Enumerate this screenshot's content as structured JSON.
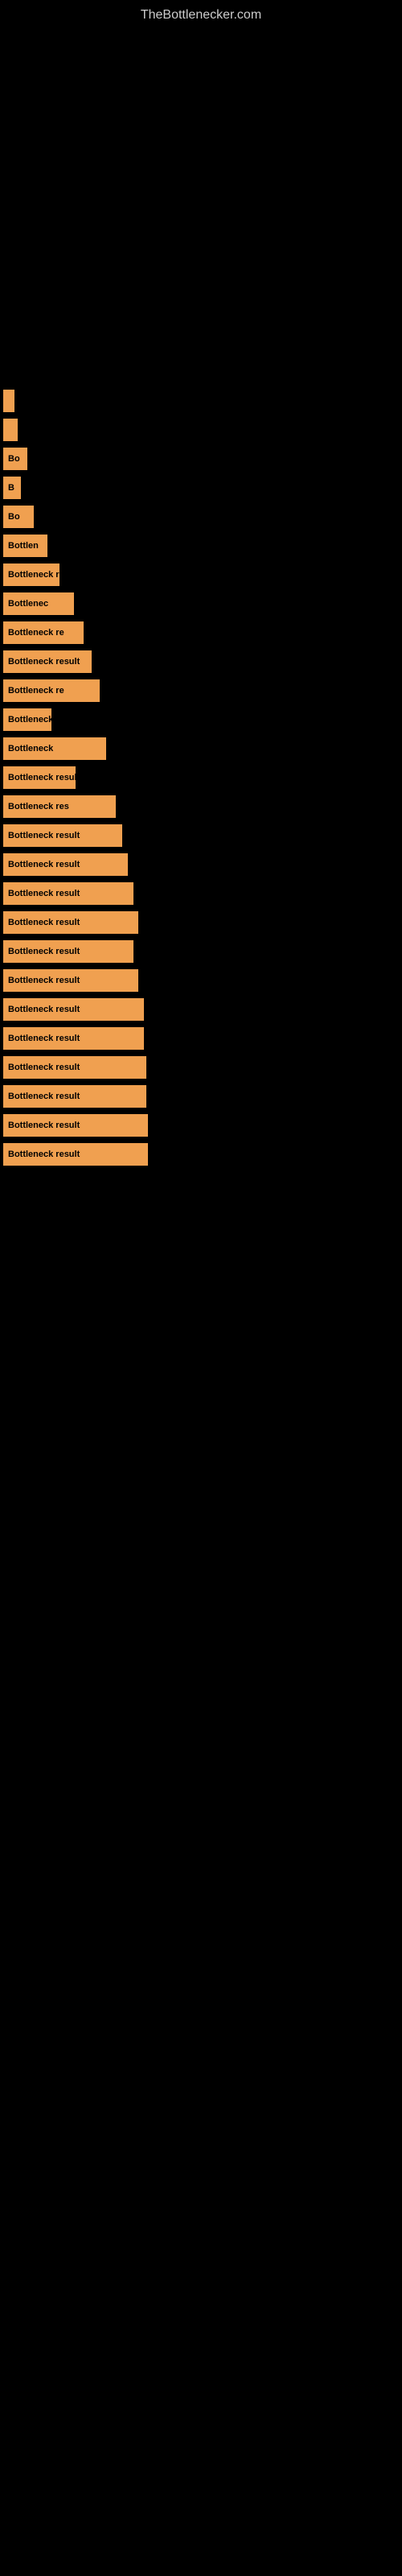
{
  "site": {
    "title": "TheBottlenecker.com"
  },
  "results": [
    {
      "id": 1,
      "label": "",
      "bar_class": "bar-1"
    },
    {
      "id": 2,
      "label": "",
      "bar_class": "bar-2"
    },
    {
      "id": 3,
      "label": "Bo",
      "bar_class": "bar-3"
    },
    {
      "id": 4,
      "label": "B",
      "bar_class": "bar-4"
    },
    {
      "id": 5,
      "label": "Bo",
      "bar_class": "bar-5"
    },
    {
      "id": 6,
      "label": "Bottlen",
      "bar_class": "bar-6"
    },
    {
      "id": 7,
      "label": "Bottleneck r",
      "bar_class": "bar-7"
    },
    {
      "id": 8,
      "label": "Bottlenec",
      "bar_class": "bar-8"
    },
    {
      "id": 9,
      "label": "Bottleneck re",
      "bar_class": "bar-9"
    },
    {
      "id": 10,
      "label": "Bottleneck result",
      "bar_class": "bar-10"
    },
    {
      "id": 11,
      "label": "Bottleneck re",
      "bar_class": "bar-11"
    },
    {
      "id": 12,
      "label": "Bottleneck res",
      "bar_class": "bar-12"
    },
    {
      "id": 13,
      "label": "Bottleneck",
      "bar_class": "bar-13"
    },
    {
      "id": 14,
      "label": "Bottleneck result",
      "bar_class": "bar-14"
    },
    {
      "id": 15,
      "label": "Bottleneck res",
      "bar_class": "bar-15"
    },
    {
      "id": 16,
      "label": "Bottleneck result",
      "bar_class": "bar-16"
    },
    {
      "id": 17,
      "label": "Bottleneck result",
      "bar_class": "bar-17"
    },
    {
      "id": 18,
      "label": "Bottleneck result",
      "bar_class": "bar-18"
    },
    {
      "id": 19,
      "label": "Bottleneck result",
      "bar_class": "bar-19"
    },
    {
      "id": 20,
      "label": "Bottleneck result",
      "bar_class": "bar-20"
    },
    {
      "id": 21,
      "label": "Bottleneck result",
      "bar_class": "bar-21"
    },
    {
      "id": 22,
      "label": "Bottleneck result",
      "bar_class": "bar-22"
    },
    {
      "id": 23,
      "label": "Bottleneck result",
      "bar_class": "bar-23"
    },
    {
      "id": 24,
      "label": "Bottleneck result",
      "bar_class": "bar-24"
    },
    {
      "id": 25,
      "label": "Bottleneck result",
      "bar_class": "bar-25"
    },
    {
      "id": 26,
      "label": "Bottleneck result",
      "bar_class": "bar-26"
    },
    {
      "id": 27,
      "label": "Bottleneck result",
      "bar_class": "bar-27"
    }
  ]
}
